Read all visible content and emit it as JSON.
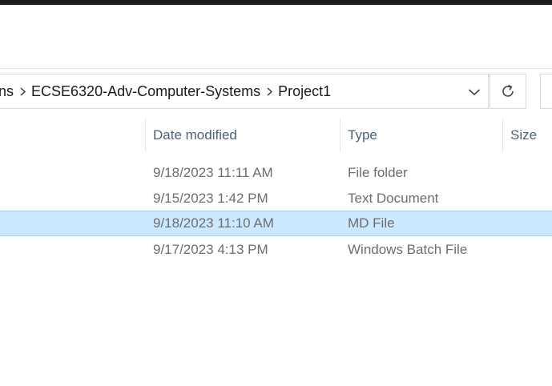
{
  "address_bar": {
    "crumbs": [
      "ns",
      "ECSE6320-Adv-Computer-Systems",
      "Project1"
    ],
    "dropdown_icon": "chevron-down-icon",
    "refresh_icon": "refresh-icon"
  },
  "columns": {
    "date_modified": "Date modified",
    "type": "Type",
    "size": "Size"
  },
  "rows": [
    {
      "date": "9/18/2023 11:11 AM",
      "type": "File folder",
      "selected": false
    },
    {
      "date": "9/15/2023 1:42 PM",
      "type": "Text Document",
      "selected": false
    },
    {
      "date": "9/18/2023 11:10 AM",
      "type": "MD File",
      "selected": true
    },
    {
      "date": "9/17/2023 4:13 PM",
      "type": "Windows Batch File",
      "selected": false
    }
  ],
  "colors": {
    "selection_bg": "#cce8ff",
    "selection_border": "#99d1ff",
    "header_text": "#4c607a",
    "cell_text": "#6d6d6d"
  }
}
